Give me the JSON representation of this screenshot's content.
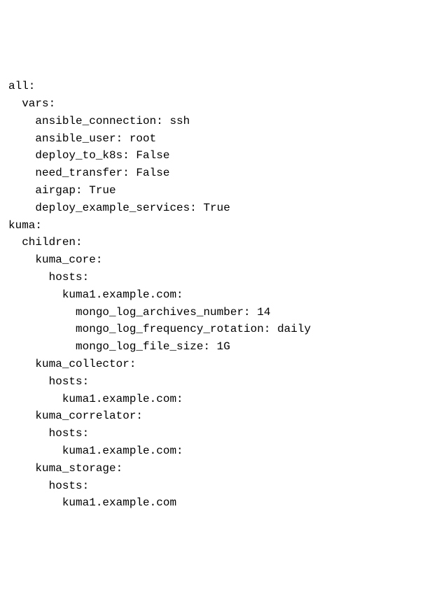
{
  "lines": [
    {
      "i": 0,
      "t": "all:"
    },
    {
      "i": 1,
      "t": "vars:"
    },
    {
      "i": 2,
      "t": "ansible_connection: ssh"
    },
    {
      "i": 2,
      "t": "ansible_user: root"
    },
    {
      "i": 2,
      "t": "deploy_to_k8s: False"
    },
    {
      "i": 2,
      "t": "need_transfer: False"
    },
    {
      "i": 2,
      "t": "airgap: True"
    },
    {
      "i": 2,
      "t": "deploy_example_services: True"
    },
    {
      "i": 0,
      "t": "kuma:"
    },
    {
      "i": 1,
      "t": "children:"
    },
    {
      "i": 2,
      "t": "kuma_core:"
    },
    {
      "i": 3,
      "t": "hosts:"
    },
    {
      "i": 4,
      "t": "kuma1.example.com:"
    },
    {
      "i": 5,
      "t": "mongo_log_archives_number: 14"
    },
    {
      "i": 5,
      "t": "mongo_log_frequency_rotation: daily"
    },
    {
      "i": 5,
      "t": "mongo_log_file_size: 1G"
    },
    {
      "i": 2,
      "t": "kuma_collector:"
    },
    {
      "i": 3,
      "t": "hosts:"
    },
    {
      "i": 4,
      "t": "kuma1.example.com:"
    },
    {
      "i": 2,
      "t": "kuma_correlator:"
    },
    {
      "i": 3,
      "t": "hosts:"
    },
    {
      "i": 4,
      "t": "kuma1.example.com:"
    },
    {
      "i": 2,
      "t": "kuma_storage:"
    },
    {
      "i": 3,
      "t": "hosts:"
    },
    {
      "i": 4,
      "t": "kuma1.example.com"
    }
  ],
  "indent_unit": "  "
}
